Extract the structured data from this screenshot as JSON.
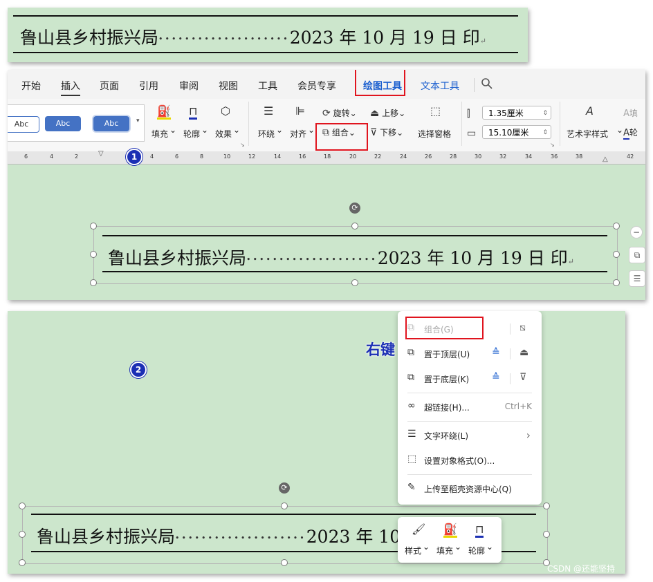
{
  "doc_line": {
    "left_text": "鲁山县乡村振兴局",
    "dots": "••••••••••••••••••••",
    "right_text": "2023 年 10 月 19 日 印",
    "para_mark": "↵"
  },
  "tabs": [
    "开始",
    "插入",
    "页面",
    "引用",
    "审阅",
    "视图",
    "工具",
    "会员专享",
    "绘图工具",
    "文本工具"
  ],
  "search_icon": "search-icon",
  "ribbon": {
    "style_boxes": [
      "Abc",
      "Abc",
      "Abc"
    ],
    "fill_label": "填充",
    "outline_label": "轮廓",
    "effect_label": "效果",
    "wrap_label": "环绕",
    "align_label": "对齐",
    "rotate_label": "旋转",
    "group_label": "组合",
    "bring_forward_label": "上移",
    "send_backward_label": "下移",
    "selection_pane_label": "选择窗格",
    "height_value": "1.35厘米",
    "width_value": "15.10厘米",
    "wordart_label": "艺术字样式",
    "text_fill_label": "填",
    "text_outline_label": "轮",
    "dropdown_caret": "⌄"
  },
  "ruler_ticks": [
    "6",
    "4",
    "2",
    "2",
    "4",
    "6",
    "8",
    "10",
    "12",
    "14",
    "16",
    "18",
    "20",
    "22",
    "24",
    "26",
    "28",
    "30",
    "32",
    "34",
    "36",
    "38",
    "42"
  ],
  "step_badges": [
    "1",
    "2"
  ],
  "right_click_label": "右键",
  "context_menu": {
    "items": [
      {
        "label": "组合(G)",
        "shortcut": ""
      },
      {
        "label": "置于顶层(U)",
        "shortcut": ""
      },
      {
        "label": "置于底层(K)",
        "shortcut": ""
      },
      {
        "label": "超链接(H)...",
        "shortcut": "Ctrl+K"
      },
      {
        "label": "文字环绕(L)",
        "shortcut": "›"
      },
      {
        "label": "设置对象格式(O)...",
        "shortcut": ""
      },
      {
        "label": "上传至稻壳资源中心(Q)",
        "shortcut": ""
      }
    ]
  },
  "mini_toolbar": {
    "style_label": "样式",
    "fill_label": "填充",
    "outline_label": "轮廓"
  },
  "watermark": "CSDN @还能坚持",
  "colors": {
    "highlight_red": "#e0141e",
    "accent_blue": "#1b5fcf",
    "page_green": "#cce6cc",
    "badge_blue": "#1b2fb4"
  }
}
